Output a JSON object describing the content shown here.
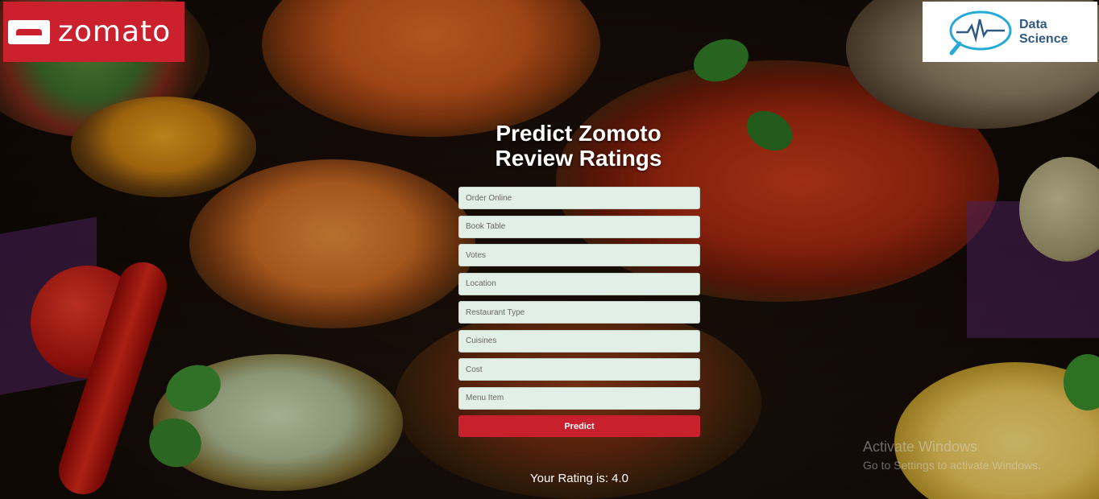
{
  "brand": {
    "zomato_logo_text": "zomato",
    "ds_logo_line1": "Data",
    "ds_logo_line2": "Science"
  },
  "page": {
    "title_line1": "Predict Zomoto",
    "title_line2": "Review Ratings"
  },
  "form": {
    "fields": [
      {
        "name": "order-online-input",
        "placeholder": "Order Online"
      },
      {
        "name": "book-table-input",
        "placeholder": "Book Table"
      },
      {
        "name": "votes-input",
        "placeholder": "Votes"
      },
      {
        "name": "location-input",
        "placeholder": "Location"
      },
      {
        "name": "restaurant-type-input",
        "placeholder": "Restaurant Type"
      },
      {
        "name": "cuisines-input",
        "placeholder": "Cuisines"
      },
      {
        "name": "cost-input",
        "placeholder": "Cost"
      },
      {
        "name": "menu-item-input",
        "placeholder": "Menu Item"
      }
    ],
    "submit_label": "Predict"
  },
  "result": {
    "text": "Your Rating is: 4.0"
  },
  "os_watermark": {
    "line1": "Activate Windows",
    "line2": "Go to Settings to activate Windows."
  },
  "colors": {
    "zomato_red": "#cb202d",
    "button_red": "#c8202d",
    "input_bg": "#e2efe6",
    "ds_blue": "#2e5a84",
    "ds_cyan": "#27a9d6"
  }
}
